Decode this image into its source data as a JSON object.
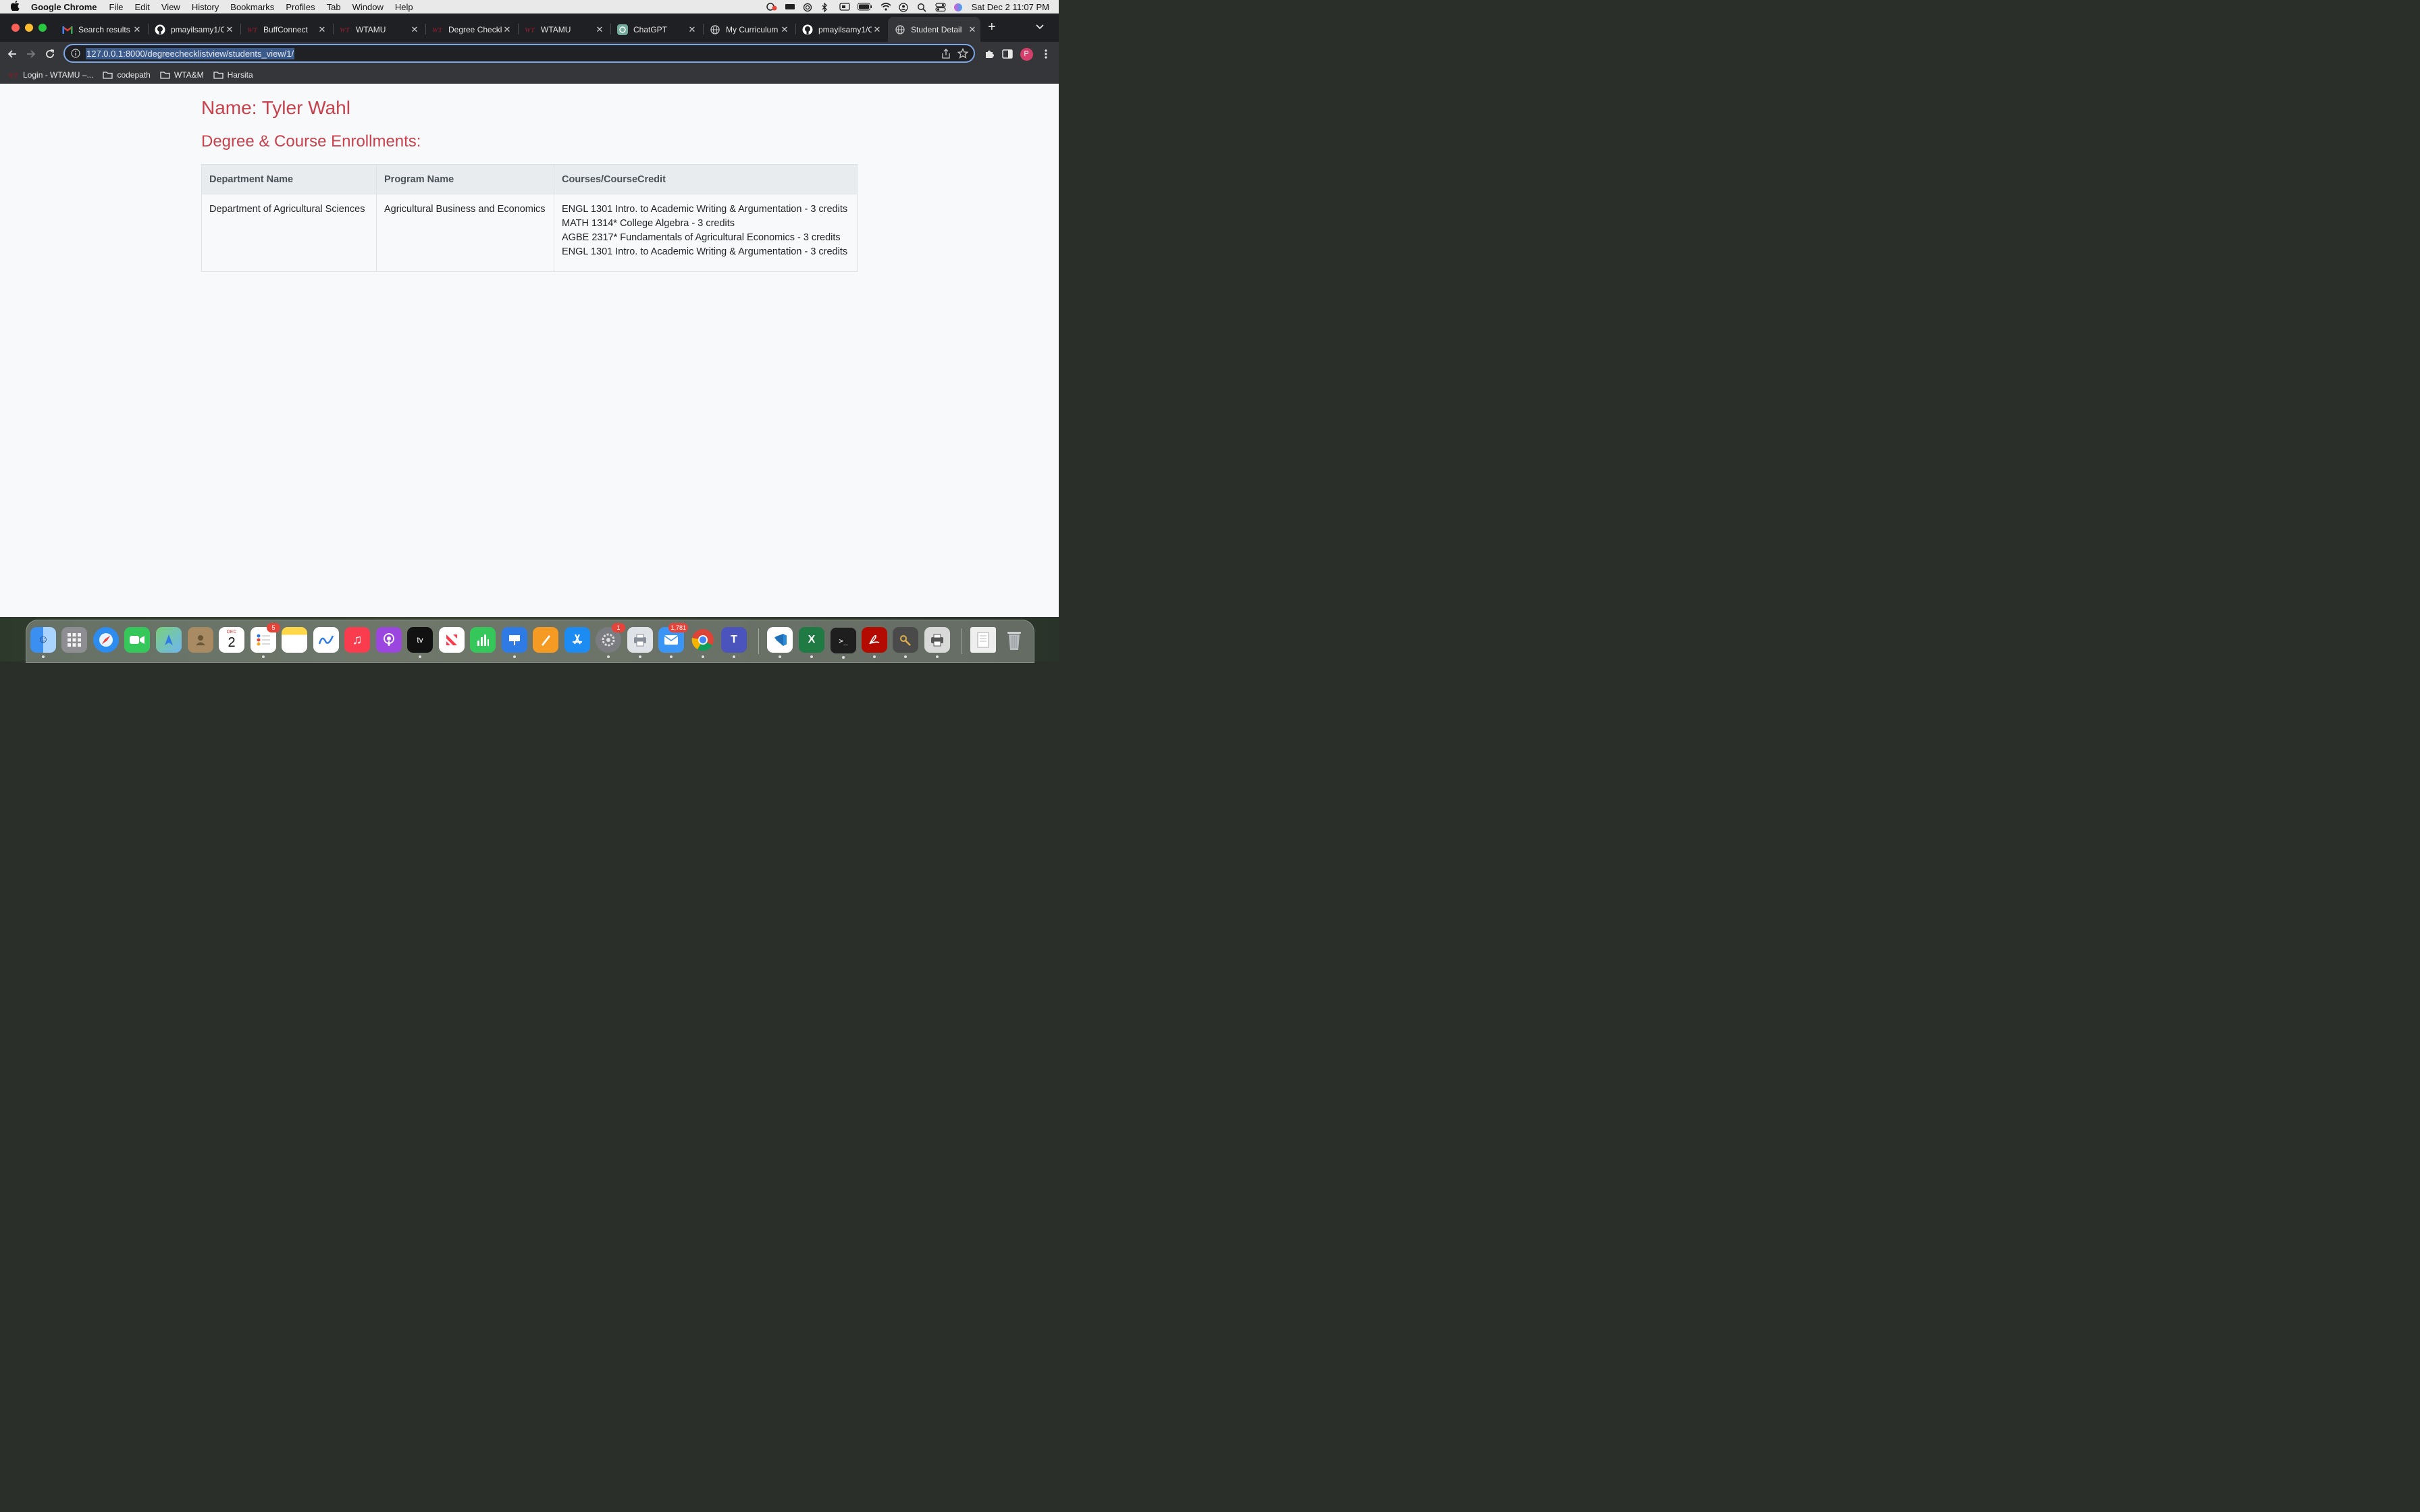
{
  "menubar": {
    "app_name": "Google Chrome",
    "items": [
      "File",
      "Edit",
      "View",
      "History",
      "Bookmarks",
      "Profiles",
      "Tab",
      "Window",
      "Help"
    ],
    "datetime": "Sat Dec 2  11:07 PM"
  },
  "tabs": [
    {
      "title": "Search results -",
      "icon": "gmail-icon"
    },
    {
      "title": "pmayilsamy1/Cl",
      "icon": "github-icon"
    },
    {
      "title": "BuffConnect",
      "icon": "wt-icon"
    },
    {
      "title": "WTAMU",
      "icon": "wt-icon"
    },
    {
      "title": "Degree Checkli",
      "icon": "wt-icon"
    },
    {
      "title": "WTAMU",
      "icon": "wt-icon"
    },
    {
      "title": "ChatGPT",
      "icon": "chatgpt-icon"
    },
    {
      "title": "My Curriculum",
      "icon": "globe-icon"
    },
    {
      "title": "pmayilsamy1/Cl",
      "icon": "github-icon"
    },
    {
      "title": "Student Detail",
      "icon": "globe-icon",
      "active": true
    }
  ],
  "toolbar": {
    "url": "127.0.0.1:8000/degreechecklistview/students_view/1/",
    "profile_initial": "P"
  },
  "bookmarks": [
    {
      "label": "Login - WTAMU –...",
      "icon": "wt-icon"
    },
    {
      "label": "codepath",
      "icon": "folder-icon"
    },
    {
      "label": "WTA&M",
      "icon": "folder-icon"
    },
    {
      "label": "Harsita",
      "icon": "folder-icon"
    }
  ],
  "page": {
    "student_name": "Name: Tyler Wahl",
    "section_heading": "Degree & Course Enrollments:",
    "table": {
      "headers": [
        "Department Name",
        "Program Name",
        "Courses/CourseCredit"
      ],
      "rows": [
        {
          "department": "Department of Agricultural Sciences",
          "program": "Agricultural Business and Economics",
          "courses": [
            "ENGL 1301 Intro. to Academic Writing & Argumentation - 3 credits",
            "MATH 1314* College Algebra - 3 credits",
            "AGBE 2317* Fundamentals of Agricultural Economics - 3 credits",
            "ENGL 1301 Intro. to Academic Writing & Argumentation - 3 credits"
          ]
        }
      ]
    }
  },
  "dock": {
    "calendar_month": "DEC",
    "calendar_day": "2",
    "reminders_badge": "5",
    "settings_badge": "1",
    "mail_badge": "1,781"
  },
  "colors": {
    "heading": "#c8414c",
    "tab_strip": "#1f2024",
    "toolbar": "#35363a",
    "omnibox_focus": "#7ea7e6"
  }
}
